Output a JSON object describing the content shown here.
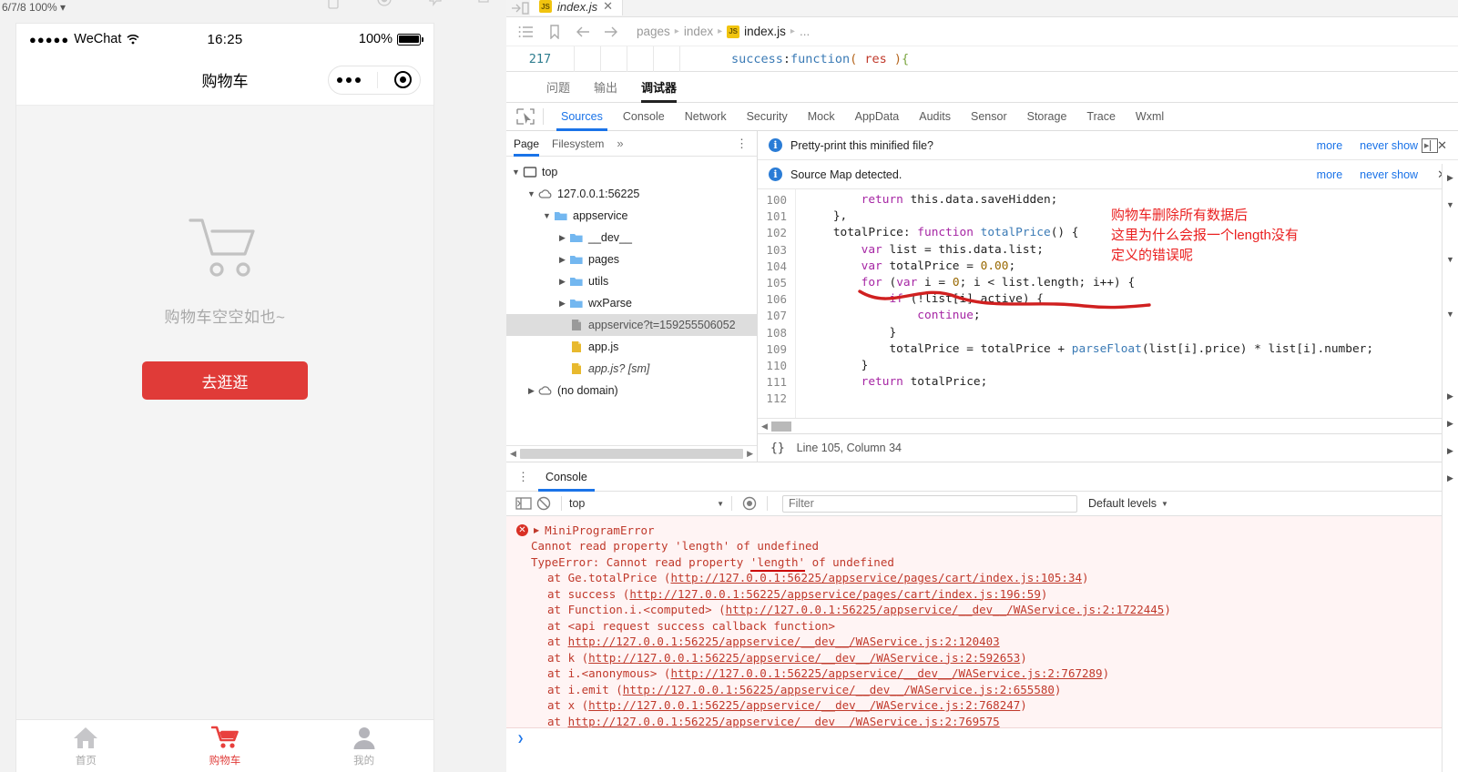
{
  "simulator": {
    "zoom_label": "6/7/8 100% ▾",
    "toolbar_icons": [
      "phone-icon",
      "record-icon",
      "feedback-icon",
      "detach-icon"
    ],
    "status_bar": {
      "carrier_dots": "●●●●●",
      "carrier": "WeChat",
      "wifi_icon": "wifi-icon",
      "time": "16:25",
      "battery_percent": "100%",
      "battery_icon": "battery-full-icon"
    },
    "nav": {
      "title": "购物车",
      "capsule_more_icon": "ellipsis-icon",
      "capsule_target_icon": "target-icon"
    },
    "page": {
      "empty_icon": "shopping-cart-outline-icon",
      "empty_text": "购物车空空如也~",
      "cta_label": "去逛逛"
    },
    "tabbar": [
      {
        "label": "首页",
        "icon": "home-icon",
        "active": false
      },
      {
        "label": "购物车",
        "icon": "cart-icon",
        "active": true
      },
      {
        "label": "我的",
        "icon": "user-icon",
        "active": false
      }
    ],
    "accent_color": "#e03b38"
  },
  "editor": {
    "tab": {
      "label": "index.js",
      "badge": "JS",
      "close": "✕"
    },
    "split_icon": "split-pane-icon",
    "breadcrumb_icons": [
      "list-icon",
      "bookmark-icon",
      "back-arrow-icon",
      "forward-arrow-icon"
    ],
    "breadcrumb": [
      "pages",
      "index",
      "index.js",
      "..."
    ],
    "breadcrumb_badge": "JS",
    "code_line_number": "217",
    "code_line": "success:function( res ){",
    "panel_tabs": [
      {
        "label": "问题",
        "active": false
      },
      {
        "label": "输出",
        "active": false
      },
      {
        "label": "调试器",
        "active": true
      }
    ]
  },
  "devtools": {
    "inspect_icon": "inspect-element-icon",
    "tabs": [
      {
        "label": "Sources",
        "active": true
      },
      {
        "label": "Console",
        "active": false
      },
      {
        "label": "Network",
        "active": false
      },
      {
        "label": "Security",
        "active": false
      },
      {
        "label": "Mock",
        "active": false
      },
      {
        "label": "AppData",
        "active": false
      },
      {
        "label": "Audits",
        "active": false
      },
      {
        "label": "Sensor",
        "active": false
      },
      {
        "label": "Storage",
        "active": false
      },
      {
        "label": "Trace",
        "active": false
      },
      {
        "label": "Wxml",
        "active": false
      }
    ],
    "nav_subtabs": [
      {
        "label": "Page",
        "active": true
      },
      {
        "label": "Filesystem",
        "active": false
      }
    ],
    "nav_more": "»",
    "nav_kebab": "⋮",
    "tree": [
      {
        "label": "top",
        "icon": "frame-icon",
        "depth": 0,
        "arrow": "▼"
      },
      {
        "label": "127.0.0.1:56225",
        "icon": "cloud-icon",
        "depth": 1,
        "arrow": "▼"
      },
      {
        "label": "appservice",
        "icon": "folder-icon",
        "depth": 2,
        "arrow": "▼"
      },
      {
        "label": "__dev__",
        "icon": "folder-icon",
        "depth": 3,
        "arrow": "▶"
      },
      {
        "label": "pages",
        "icon": "folder-icon",
        "depth": 3,
        "arrow": "▶"
      },
      {
        "label": "utils",
        "icon": "folder-icon",
        "depth": 3,
        "arrow": "▶"
      },
      {
        "label": "wxParse",
        "icon": "folder-icon",
        "depth": 3,
        "arrow": "▶"
      },
      {
        "label": "appservice?t=159255506052",
        "icon": "file-grey-icon",
        "depth": 3,
        "arrow": "",
        "selected": true
      },
      {
        "label": "app.js",
        "icon": "file-js-icon",
        "depth": 3,
        "arrow": ""
      },
      {
        "label": "app.js? [sm]",
        "icon": "file-js-icon",
        "depth": 3,
        "arrow": "",
        "italic": true
      },
      {
        "label": "(no domain)",
        "icon": "cloud-icon",
        "depth": 1,
        "arrow": "▶"
      }
    ],
    "editor_tab": {
      "label": "index.js",
      "close": "✕",
      "prev_icon": "prev-pane-icon",
      "next_icon": "next-pane-icon"
    },
    "infobars": [
      {
        "message": "Pretty-print this minified file?",
        "more": "more",
        "never": "never show",
        "close": "✕"
      },
      {
        "message": "Source Map detected.",
        "more": "more",
        "never": "never show",
        "close": "✕"
      }
    ],
    "code": {
      "first_line": 100,
      "lines": [
        "        return this.data.saveHidden;",
        "    },",
        "    totalPrice: function totalPrice() {",
        "        var list = this.data.list;",
        "        var totalPrice = 0.00;",
        "        for (var i = 0; i < list.length; i++) {",
        "            if (!list[i].active) {",
        "                continue;",
        "            }",
        "            totalPrice = totalPrice + parseFloat(list[i].price) * list[i].number;",
        "        }",
        "        return totalPrice;"
      ],
      "line_numbers": [
        "100",
        "101",
        "102",
        "103",
        "104",
        "105",
        "106",
        "107",
        "108",
        "109",
        "110",
        "111",
        "112"
      ],
      "annotation": "购物车删除所有数据后\n这里为什么会报一个length没有\n定义的错误呢",
      "annotation_color": "#ea2020"
    },
    "status": {
      "format_icon": "{}",
      "position": "Line 105, Column 34"
    },
    "console": {
      "tab_label": "Console",
      "kebab": "⋮",
      "toolbar_icons": [
        "sidebar-toggle-icon",
        "clear-console-icon",
        "eye-icon"
      ],
      "context": "top",
      "filter_placeholder": "Filter",
      "levels": "Default levels",
      "error": {
        "title": "MiniProgramError",
        "message": "Cannot read property 'length' of undefined",
        "type_line_prefix": "TypeError: Cannot read property ",
        "type_line_highlight": "'length'",
        "type_line_suffix": " of undefined",
        "stack": [
          "at Ge.totalPrice (http://127.0.0.1:56225/appservice/pages/cart/index.js:105:34)",
          "at success (http://127.0.0.1:56225/appservice/pages/cart/index.js:196:59)",
          "at Function.i.<computed> (http://127.0.0.1:56225/appservice/__dev__/WAService.js:2:1722445)",
          "at <api request success callback function>",
          "at http://127.0.0.1:56225/appservice/__dev__/WAService.js:2:120403",
          "at k (http://127.0.0.1:56225/appservice/__dev__/WAService.js:2:592653)",
          "at i.<anonymous> (http://127.0.0.1:56225/appservice/__dev__/WAService.js:2:767289)",
          "at i.emit (http://127.0.0.1:56225/appservice/__dev__/WAService.js:2:655580)",
          "at x (http://127.0.0.1:56225/appservice/__dev__/WAService.js:2:768247)",
          "at http://127.0.0.1:56225/appservice/__dev__/WAService.js:2:769575"
        ]
      },
      "prompt": "❯"
    }
  }
}
